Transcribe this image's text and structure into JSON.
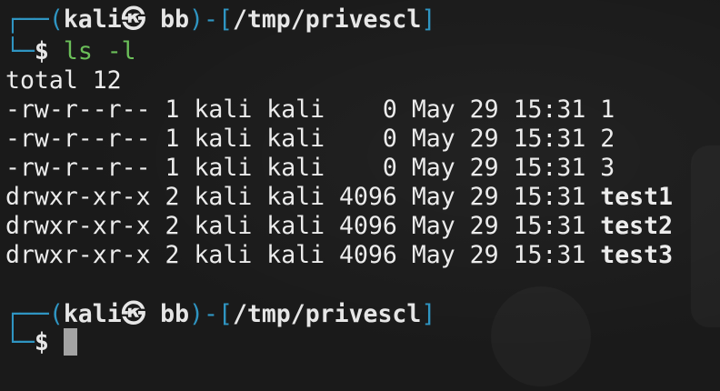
{
  "prompt1": {
    "corner_top": "┌──",
    "open": "(",
    "user": "kali㉿ bb",
    "close": ")",
    "dash": "-",
    "path_open": "[",
    "path": "/tmp/privescl",
    "path_close": "]",
    "corner_bottom": "└─",
    "dollar": "$",
    "command": "ls -l"
  },
  "output": {
    "total": "total 12",
    "rows": [
      {
        "perm": "-rw-r--r--",
        "links": "1",
        "owner": "kali",
        "group": "kali",
        "size": "   0",
        "date": "May 29 15:31",
        "name": "1",
        "is_dir": false
      },
      {
        "perm": "-rw-r--r--",
        "links": "1",
        "owner": "kali",
        "group": "kali",
        "size": "   0",
        "date": "May 29 15:31",
        "name": "2",
        "is_dir": false
      },
      {
        "perm": "-rw-r--r--",
        "links": "1",
        "owner": "kali",
        "group": "kali",
        "size": "   0",
        "date": "May 29 15:31",
        "name": "3",
        "is_dir": false
      },
      {
        "perm": "drwxr-xr-x",
        "links": "2",
        "owner": "kali",
        "group": "kali",
        "size": "4096",
        "date": "May 29 15:31",
        "name": "test1",
        "is_dir": true
      },
      {
        "perm": "drwxr-xr-x",
        "links": "2",
        "owner": "kali",
        "group": "kali",
        "size": "4096",
        "date": "May 29 15:31",
        "name": "test2",
        "is_dir": true
      },
      {
        "perm": "drwxr-xr-x",
        "links": "2",
        "owner": "kali",
        "group": "kali",
        "size": "4096",
        "date": "May 29 15:31",
        "name": "test3",
        "is_dir": true
      }
    ]
  },
  "prompt2": {
    "corner_top": "┌──",
    "open": "(",
    "user": "kali㉿ bb",
    "close": ")",
    "dash": "-",
    "path_open": "[",
    "path": "/tmp/privescl",
    "path_close": "]",
    "corner_bottom": "└─",
    "dollar": "$"
  },
  "colors": {
    "background": "#1a1a1a",
    "prompt_frame": "#2f95c2",
    "command": "#6bbf59",
    "text": "#ececec",
    "cursor": "#a3a3a3"
  }
}
